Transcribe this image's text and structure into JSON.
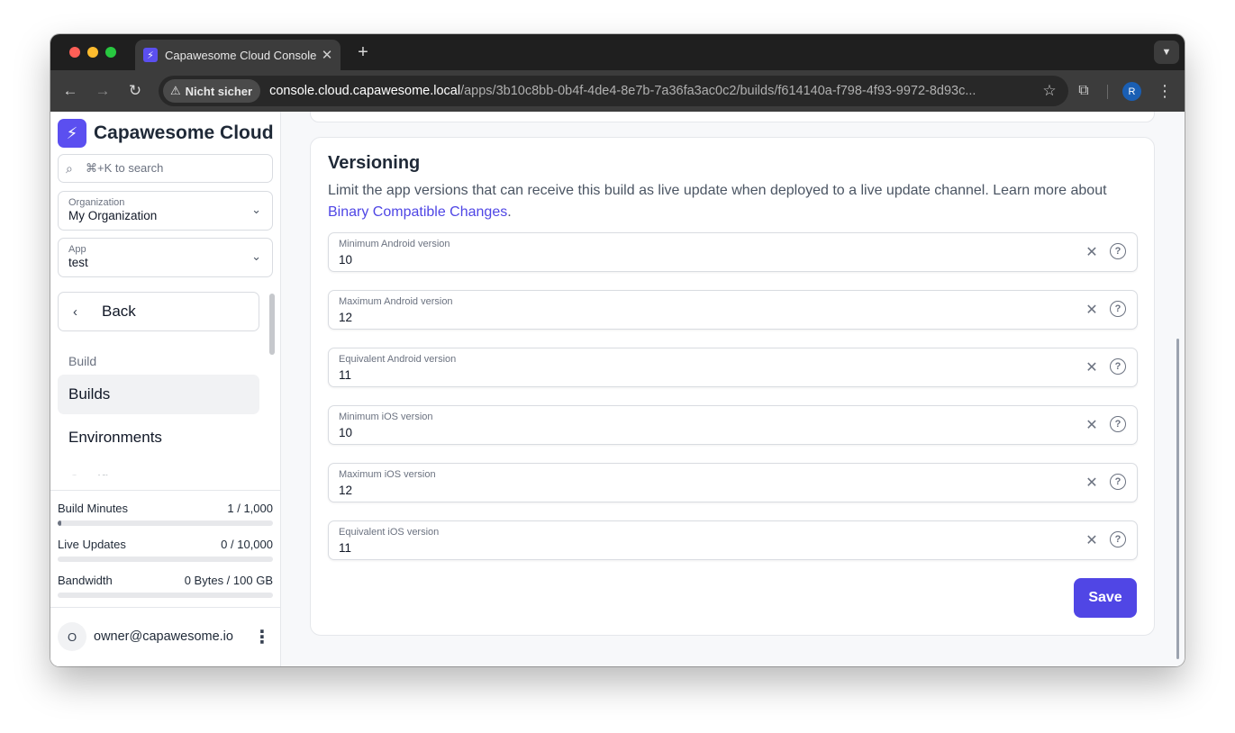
{
  "browser": {
    "tab_title": "Capawesome Cloud Console",
    "security_label": "Nicht sicher",
    "url_host": "console.cloud.capawesome.local",
    "url_path": "/apps/3b10c8bb-0b4f-4de4-8e7b-7a36fa3ac0c2/builds/f614140a-f798-4f93-9972-8d93c...",
    "profile_initial": "R"
  },
  "sidebar": {
    "brand": "Capawesome Cloud",
    "search_placeholder": "⌘+K to search",
    "organization": {
      "label": "Organization",
      "value": "My Organization"
    },
    "app": {
      "label": "App",
      "value": "test"
    },
    "back_label": "Back",
    "section": "Build",
    "items": [
      {
        "label": "Builds",
        "active": true
      },
      {
        "label": "Environments",
        "active": false
      },
      {
        "label": "Certificates",
        "active": false
      }
    ],
    "usage": [
      {
        "label": "Build Minutes",
        "value": "1 / 1,000",
        "fraction": 0.001
      },
      {
        "label": "Live Updates",
        "value": "0 / 10,000",
        "fraction": 0
      },
      {
        "label": "Bandwidth",
        "value": "0 Bytes / 100 GB",
        "fraction": 0
      }
    ],
    "account": {
      "initial": "O",
      "email": "owner@capawesome.io"
    }
  },
  "versioning": {
    "title": "Versioning",
    "description": "Limit the app versions that can receive this build as live update when deployed to a live update channel. Learn more about",
    "link": "Binary Compatible Changes",
    "fields": [
      {
        "label": "Minimum Android version",
        "value": "10"
      },
      {
        "label": "Maximum Android version",
        "value": "12"
      },
      {
        "label": "Equivalent Android version",
        "value": "11"
      },
      {
        "label": "Minimum iOS version",
        "value": "10"
      },
      {
        "label": "Maximum iOS version",
        "value": "12"
      },
      {
        "label": "Equivalent iOS version",
        "value": "11"
      }
    ],
    "save_label": "Save"
  },
  "colors": {
    "accent": "#5046e5",
    "brand": "#5b4ff0"
  }
}
